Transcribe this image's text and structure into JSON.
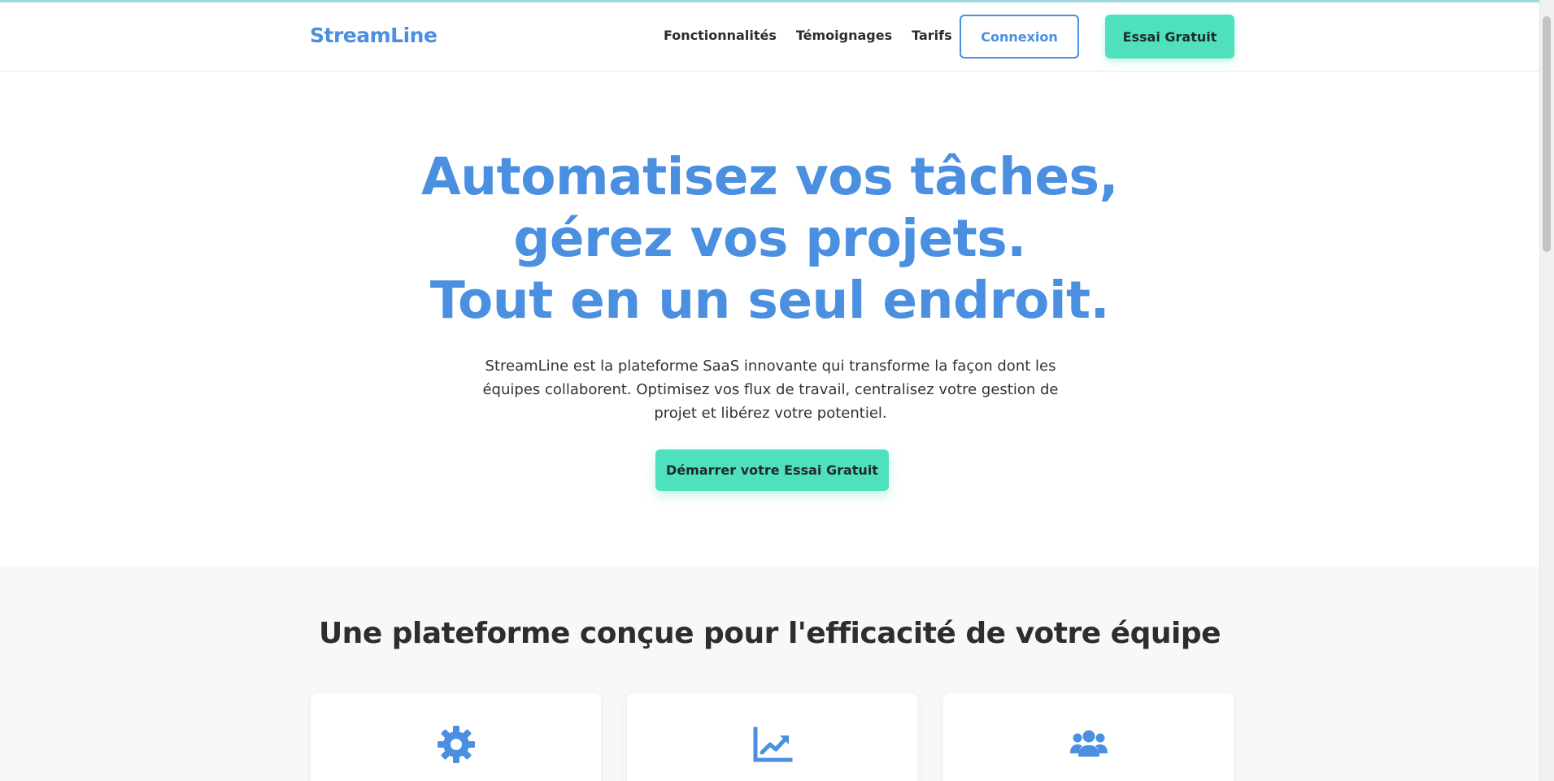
{
  "brand": {
    "name": "StreamLine",
    "accent": "#4a8fe0",
    "cta_color": "#4fe0bd"
  },
  "header": {
    "nav": [
      {
        "label": "Fonctionnalités"
      },
      {
        "label": "Témoignages"
      },
      {
        "label": "Tarifs"
      }
    ],
    "login_label": "Connexion",
    "trial_label": "Essai Gratuit"
  },
  "hero": {
    "title_lines": [
      "Automatisez vos tâches,",
      "gérez vos projets.",
      "Tout en un seul endroit."
    ],
    "description": "StreamLine est la plateforme SaaS innovante qui transforme la façon dont les équipes collaborent. Optimisez vos flux de travail, centralisez votre gestion de projet et libérez votre potentiel.",
    "cta_label": "Démarrer votre Essai Gratuit"
  },
  "features": {
    "title": "Une plateforme conçue pour l'efficacité de votre équipe",
    "cards": [
      {
        "icon": "gear-icon"
      },
      {
        "icon": "chart-line-icon"
      },
      {
        "icon": "users-icon"
      }
    ]
  }
}
